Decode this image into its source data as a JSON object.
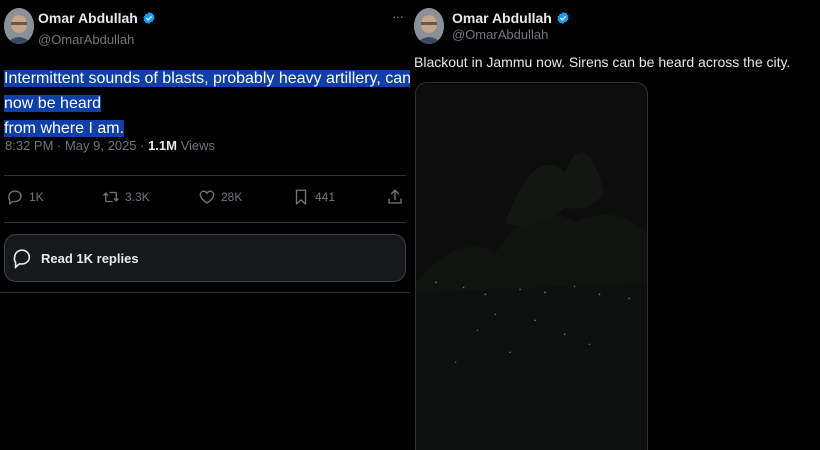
{
  "left_tweet": {
    "author_name": "Omar Abdullah",
    "author_handle": "@OmarAbdullah",
    "text_line1": "Intermittent sounds of blasts, probably heavy artillery, can now be heard",
    "text_line2": "from where I am.",
    "time": "8:32 PM · May 9, 2025 · ",
    "views_count": "1.1M",
    "views_label": " Views",
    "actions": {
      "replies": "1K",
      "reposts": "3.3K",
      "likes": "28K",
      "bookmarks": "441"
    },
    "read_replies_label": "Read 1K replies"
  },
  "right_tweet": {
    "author_name": "Omar Abdullah",
    "author_handle": "@OmarAbdullah",
    "text": "Blackout in Jammu now. Sirens can be heard across the city."
  },
  "colors": {
    "background": "#000000",
    "text_primary": "#e7e9ea",
    "text_secondary": "#71767b",
    "verified_badge": "#1d9bf0",
    "text_highlight": "#0f3fa8"
  },
  "icons": [
    "verified-badge-icon",
    "reply-icon",
    "repost-icon",
    "like-icon",
    "bookmark-icon",
    "share-icon",
    "more-options-icon",
    "speech-bubble-icon"
  ]
}
